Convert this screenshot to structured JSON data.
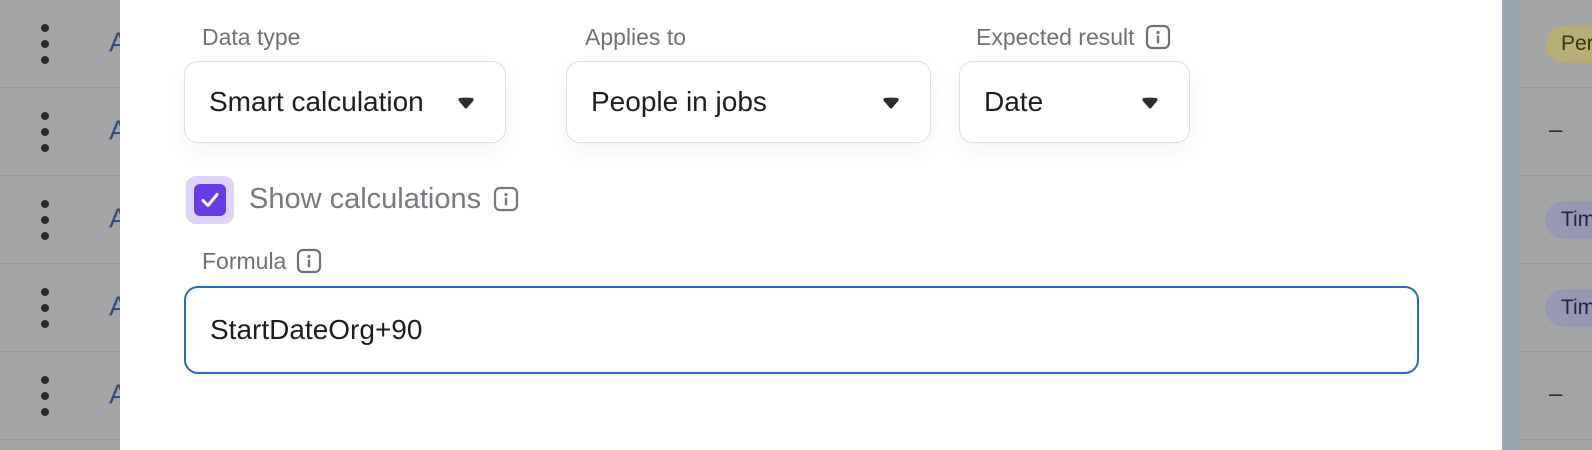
{
  "left_list": {
    "rows": [
      {
        "letter": "A"
      },
      {
        "letter": "A"
      },
      {
        "letter": "A"
      },
      {
        "letter": "A"
      },
      {
        "letter": "A"
      }
    ]
  },
  "right_list": {
    "rows": [
      {
        "text": "Per",
        "kind": "badge-yellow"
      },
      {
        "text": "–",
        "kind": "dash"
      },
      {
        "text": "Tim",
        "kind": "badge-purple"
      },
      {
        "text": "Tim",
        "kind": "badge-purple"
      },
      {
        "text": "–",
        "kind": "dash"
      }
    ]
  },
  "form": {
    "data_type": {
      "label": "Data type",
      "value": "Smart calculation"
    },
    "applies_to": {
      "label": "Applies to",
      "value": "People in jobs"
    },
    "expected_result": {
      "label": "Expected result",
      "value": "Date"
    },
    "show_calculations": {
      "label": "Show calculations",
      "checked": true
    },
    "formula": {
      "label": "Formula",
      "value": "StartDateOrg+90"
    }
  },
  "colors": {
    "accent_checkbox": "#6a3be2",
    "focus_border": "#1f6dc7",
    "overlay": "#a4a5a7"
  },
  "icons": {
    "info": "info-icon",
    "caret": "caret-down-icon",
    "kebab": "kebab-menu-icon",
    "check": "check-icon"
  }
}
